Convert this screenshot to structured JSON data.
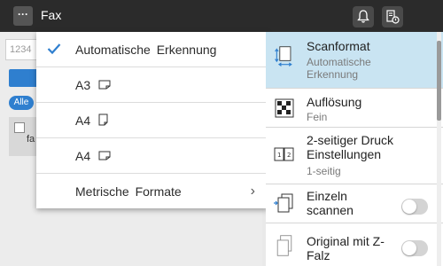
{
  "header": {
    "menu_label": "···",
    "title": "Fax",
    "icons": [
      "bell-icon",
      "document-status-icon"
    ]
  },
  "background": {
    "number_field_placeholder": "1234",
    "filter_chip": "Alle",
    "card_text": "fa"
  },
  "dropdown": {
    "items": [
      {
        "label": "Automatische  Erkennung",
        "selected": true,
        "icon": "checkmark-icon"
      },
      {
        "label": "A3",
        "icon": "paper-landscape-icon"
      },
      {
        "label": "A4",
        "icon": "paper-portrait-icon"
      },
      {
        "label": "A4",
        "icon": "paper-landscape-icon"
      },
      {
        "label": "Metrische  Formate",
        "has_submenu": true,
        "chevron": "›"
      }
    ]
  },
  "settings": {
    "items": [
      {
        "title": "Scanformat",
        "subtitle": "Automatische Erkennung",
        "icon": "scan-size-icon",
        "selected": true
      },
      {
        "title": "Auflösung",
        "subtitle": "Fein",
        "icon": "resolution-icon"
      },
      {
        "title": "2-seitiger  Druck Einstellungen",
        "subtitle": "1-seitig",
        "icon": "duplex-icon"
      },
      {
        "title": "Einzeln scannen",
        "icon": "separate-scan-icon",
        "toggle": false
      },
      {
        "title": "Original  mit Z-Falz",
        "icon": "z-fold-icon",
        "toggle": false
      }
    ]
  },
  "colors": {
    "topbar": "#2b2b2b",
    "selected_row": "#c9e4f2",
    "accent_blue": "#2f7fcf"
  }
}
